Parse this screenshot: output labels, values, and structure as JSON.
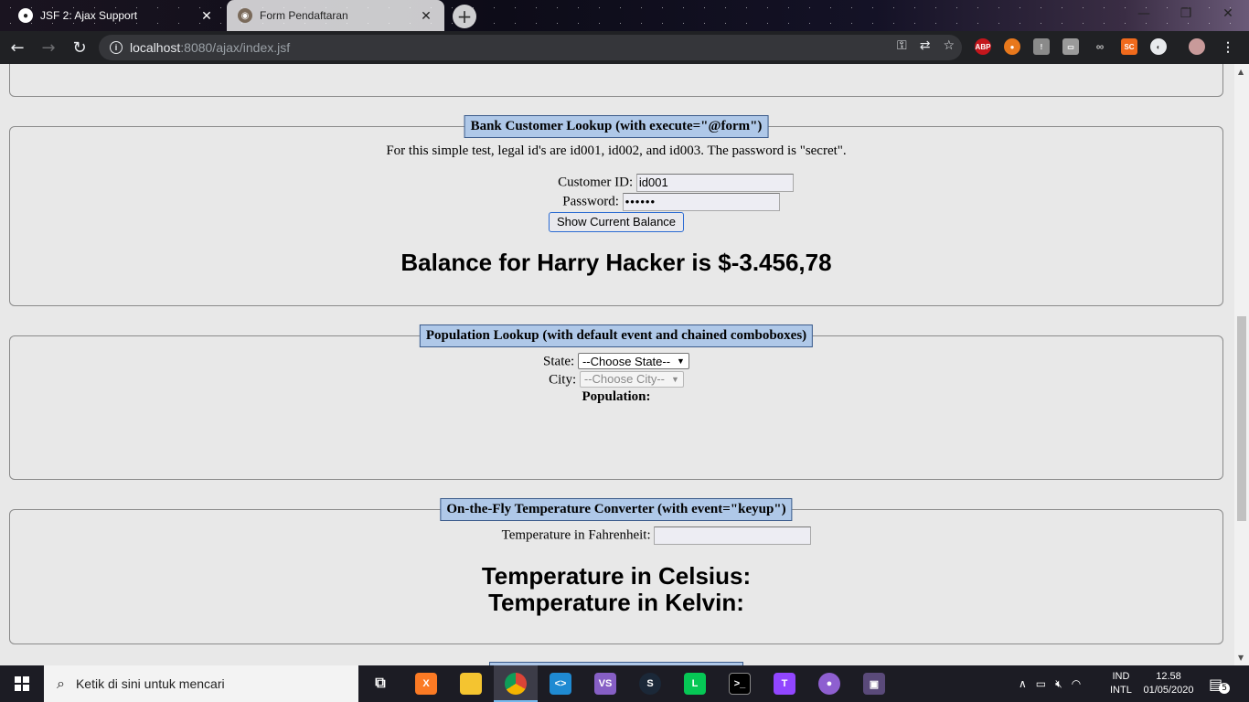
{
  "browser": {
    "tabs": [
      {
        "title": "JSF 2: Ajax Support",
        "active": true
      },
      {
        "title": "Form Pendaftaran",
        "active": false
      }
    ],
    "new_tab_label": "+",
    "url_host": "localhost",
    "url_rest": ":8080/ajax/index.jsf"
  },
  "bank": {
    "legend": "Bank Customer Lookup (with execute=\"@form\")",
    "note": "For this simple test, legal id's are id001, id002, and id003. The password is \"secret\".",
    "customer_id_label": "Customer ID:",
    "customer_id_value": "id001",
    "password_label": "Password:",
    "password_value": "••••••",
    "button_label": "Show Current Balance",
    "result": "Balance for Harry Hacker is $-3.456,78"
  },
  "population": {
    "legend": "Population Lookup (with default event and chained comboboxes)",
    "state_label": "State:",
    "state_selected": "--Choose State--",
    "city_label": "City:",
    "city_selected": "--Choose City--",
    "population_label": "Population:"
  },
  "temperature": {
    "legend": "On-the-Fly Temperature Converter (with event=\"keyup\")",
    "fahrenheit_label": "Temperature in Fahrenheit:",
    "fahrenheit_value": "",
    "celsius_label": "Temperature in Celsius:",
    "kelvin_label": "Temperature in Kelvin:"
  },
  "taskbar": {
    "search_placeholder": "Ketik di sini untuk mencari",
    "lang_top": "IND",
    "lang_bottom": "INTL",
    "time": "12.58",
    "date": "01/05/2020",
    "notification_count": "5"
  },
  "colors": {
    "legend_bg": "#afc8e8",
    "page_bg": "#e8e8e8",
    "button_focus": "#2b6bd2"
  }
}
